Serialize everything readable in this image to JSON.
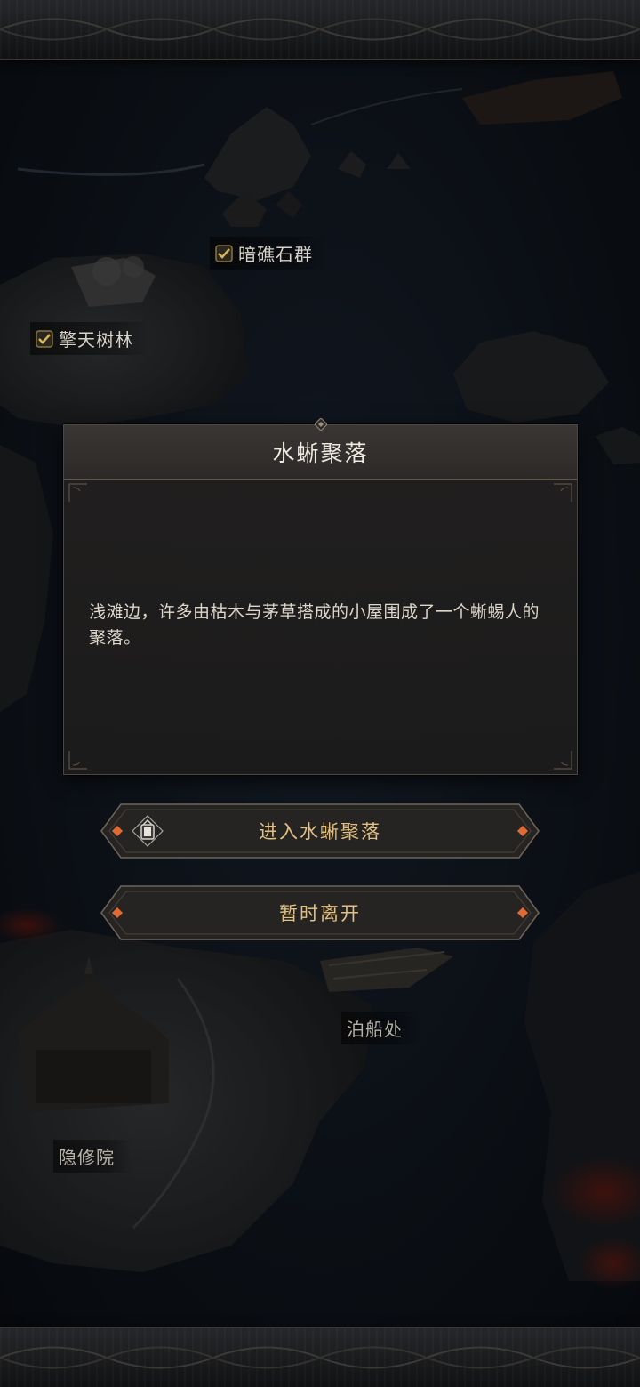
{
  "map": {
    "locations": [
      {
        "name": "暗礁石群",
        "visited": true
      },
      {
        "name": "擎天树林",
        "visited": true
      },
      {
        "name": "泊船处",
        "visited": false
      },
      {
        "name": "隐修院",
        "visited": false
      }
    ]
  },
  "dialog": {
    "title": "水蜥聚落",
    "description": "浅滩边，许多由枯木与茅草搭成的小屋围成了一个蜥蜴人的聚落。"
  },
  "actions": {
    "enter_label": "进入水蜥聚落",
    "leave_label": "暂时离开"
  },
  "colors": {
    "accent_gold": "#e2c082",
    "button_diamond": "#e06a35",
    "check_gold": "#c9a548"
  },
  "icons": {
    "check": "check-icon",
    "lantern": "lantern-icon"
  }
}
